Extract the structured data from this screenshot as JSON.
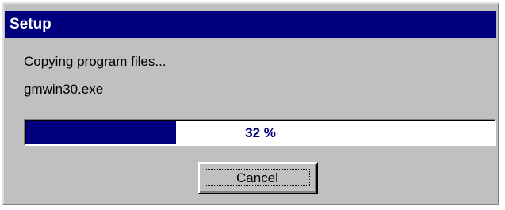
{
  "dialog": {
    "title": "Setup",
    "status_text": "Copying program files...",
    "current_file": "gmwin30.exe",
    "progress": {
      "percent": 32,
      "label": "32 %"
    },
    "cancel_label": "Cancel"
  },
  "colors": {
    "titlebar": "#00007f",
    "progress_fill": "#00007f",
    "dialog_face": "#c0c0c0"
  }
}
